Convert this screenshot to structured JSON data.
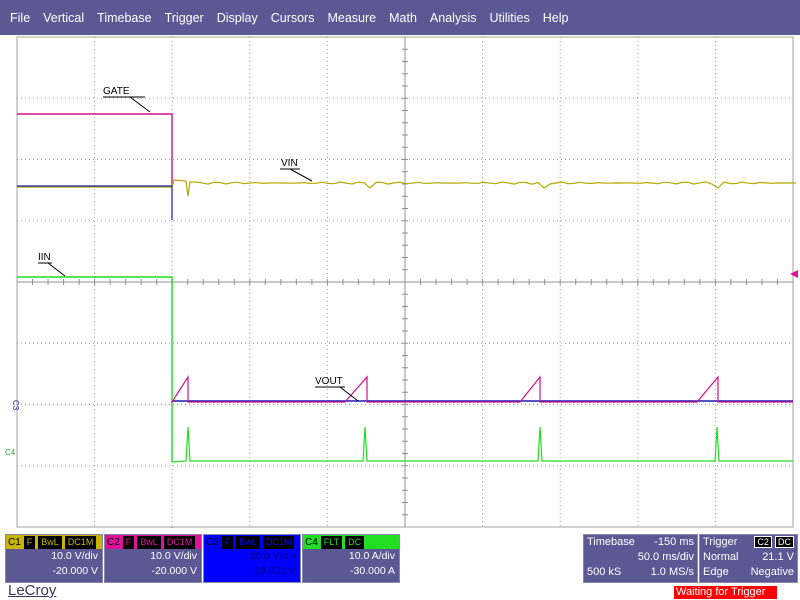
{
  "menu": [
    "File",
    "Vertical",
    "Timebase",
    "Trigger",
    "Display",
    "Cursors",
    "Measure",
    "Math",
    "Analysis",
    "Utilities",
    "Help"
  ],
  "trace_labels": {
    "gate": "GATE",
    "vin": "VIN",
    "iin": "IIN",
    "vout": "VOUT"
  },
  "edge_labels": {
    "c3": "C3",
    "c4": "C4"
  },
  "channels": [
    {
      "name": "C1",
      "tags": [
        "F",
        "BwL",
        "DC1M"
      ],
      "scale": "10.0 V/div",
      "offset": "-20.000 V",
      "color": "#c8b400",
      "bg": "#5b5894"
    },
    {
      "name": "C2",
      "tags": [
        "F",
        "BwL",
        "DC1M"
      ],
      "scale": "10.0 V/div",
      "offset": "-20.000 V",
      "color": "#e0109a",
      "bg": "#5b5894"
    },
    {
      "name": "C3",
      "tags": [
        "F",
        "BwL",
        "DC1M"
      ],
      "scale": "10.0 V/div",
      "offset": "-19.800 V",
      "color": "#0000ff",
      "bg": "#0000ff"
    },
    {
      "name": "C4",
      "tags": [
        "FLT",
        "DC"
      ],
      "scale": "10.0 A/div",
      "offset": "-30.000 A",
      "color": "#22dd22",
      "bg": "#5b5894"
    }
  ],
  "timebase": {
    "label": "Timebase",
    "delay": "-150 ms",
    "scale": "50.0 ms/div",
    "samples": "500 kS",
    "rate": "1.0 MS/s"
  },
  "trigger": {
    "label": "Trigger",
    "source": "C2",
    "coupling": "DC",
    "mode": "Normal",
    "level": "21.1 V",
    "type": "Edge",
    "slope": "Negative"
  },
  "brand": "LeCroy",
  "status": "Waiting for Trigger",
  "colors": {
    "menubar": "#5b5894",
    "c1": "#b8a800",
    "c2": "#d0108c",
    "c3": "#1c1cb0",
    "c4": "#22dd22"
  }
}
